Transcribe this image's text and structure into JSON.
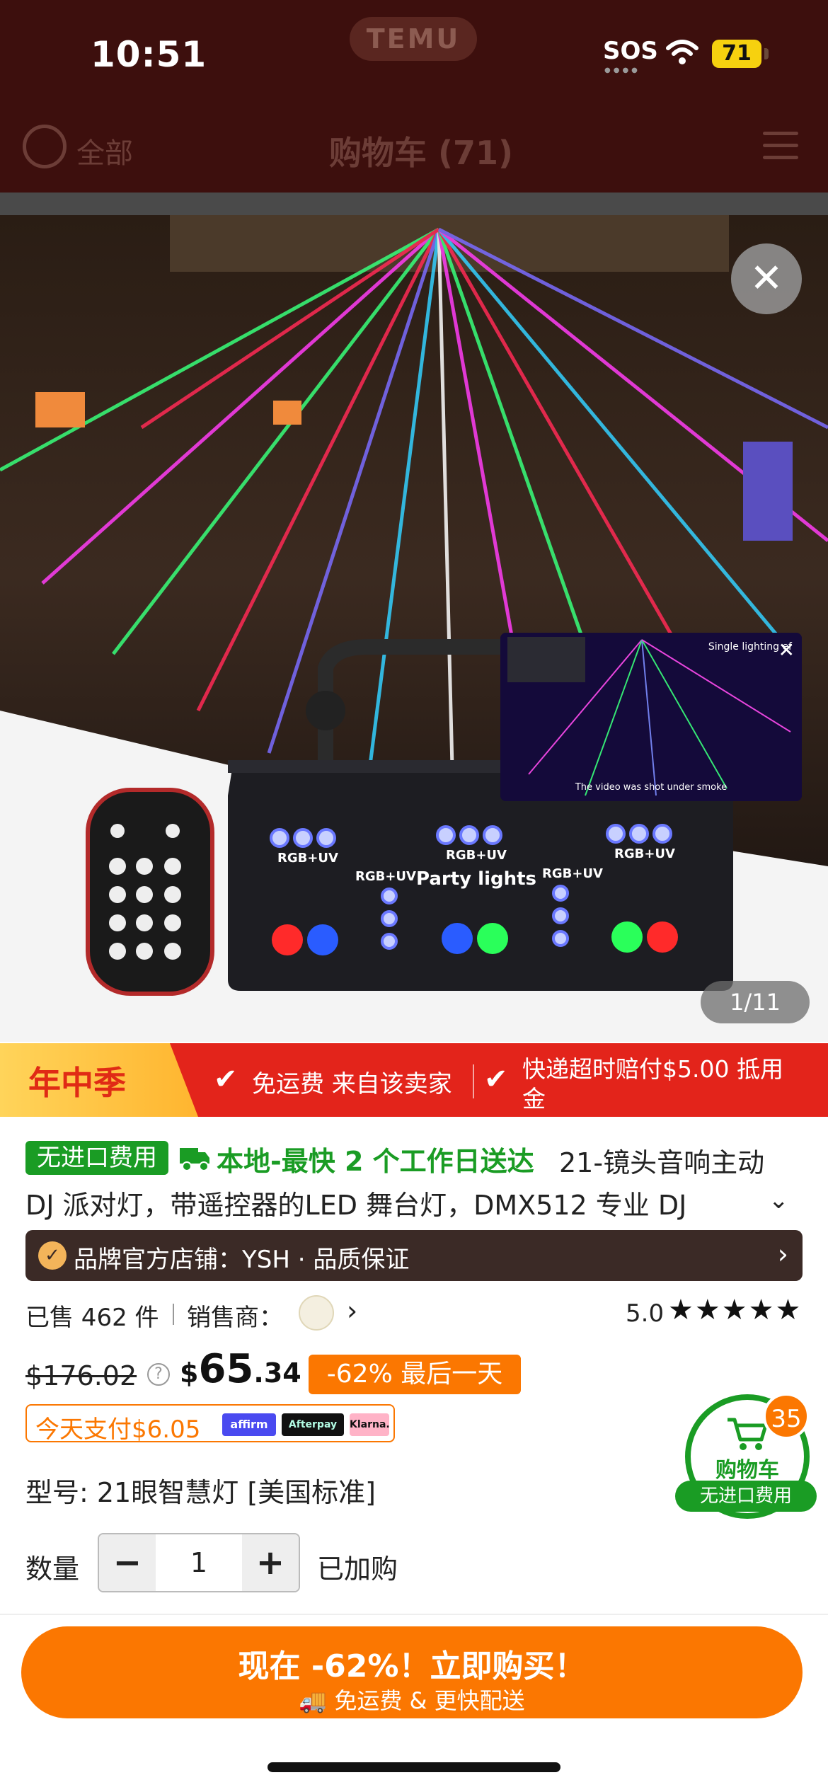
{
  "status_bar": {
    "time": "10:51",
    "sos": "SOS",
    "battery": "71"
  },
  "app": {
    "logo": "TEMU"
  },
  "cart_header": {
    "select_all": "全部",
    "title": "购物车 (71)",
    "menu_icon": "list-menu-icon"
  },
  "gallery": {
    "close_icon": "close-icon",
    "page": "1/11",
    "video_thumb": {
      "top_text": "Single lighting ef",
      "bottom_text": "The video was shot under smoke"
    },
    "product_labels": {
      "center_label": "Party lights",
      "led_group": "RGB+UV"
    }
  },
  "promo": {
    "season": "年中季",
    "item1": "免运费 来自该卖家",
    "item2_line1": "快递超时赔付$5.00 抵用",
    "item2_line2": "金",
    "check_icon": "check-icon"
  },
  "product": {
    "no_import_badge": "无进口费用",
    "delivery": "本地-最快 2 个工作日送达",
    "title_line1": "21-镜头音响主动",
    "title_line2": "DJ 派对灯，带遥控器的LED 舞台灯，DMX512 专业 DJ",
    "brand_bar": "品牌官方店铺：YSH · 品质保证",
    "sold": "已售 462 件",
    "seller_label": "销售商：",
    "rating": "5.0",
    "stars": "★★★★★",
    "price_original": "$176.02",
    "price_symbol": "$",
    "price_int": "65",
    "price_dec": ".34",
    "discount": "-62% 最后一天",
    "pay_today": "今天支付$6.05",
    "pay_partners": [
      "affirm",
      "Afterpay",
      "Klarna."
    ],
    "model": "型号: 21眼智慧灯 [美国标准]"
  },
  "floating_cart": {
    "count": "35",
    "label": "购物车",
    "sub": "无进口费用"
  },
  "quantity": {
    "label": "数量",
    "value": "1",
    "minus": "−",
    "plus": "+",
    "in_cart": "已加购"
  },
  "buy_button": {
    "main": "现在 -62%！立即购买！",
    "sub": "免运费 & 更快配送"
  },
  "colors": {
    "accent": "#fb7701",
    "promo_red": "#e3241b",
    "green": "#1a9c24"
  }
}
